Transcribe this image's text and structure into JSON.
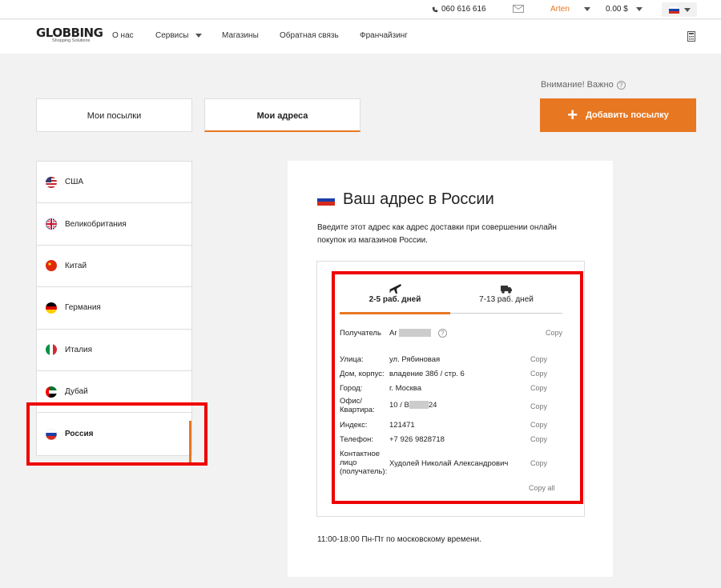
{
  "topbar": {
    "phone": "060 616 616",
    "user": "Arten",
    "balance": "0.00 $"
  },
  "nav": {
    "logo": "GLOBBING",
    "logo_sub": "Shopping Solutions",
    "links": [
      "О нас",
      "Сервисы",
      "Магазины",
      "Обратная связь",
      "Франчайзинг"
    ]
  },
  "notice": "Внимание! Важно",
  "tabs": {
    "parcels": "Мои посылки",
    "addresses": "Мои адреса"
  },
  "add_button": "Добавить посылку",
  "countries": [
    "США",
    "Великобритания",
    "Китай",
    "Германия",
    "Италия",
    "Дубай",
    "Россия"
  ],
  "card": {
    "title": "Ваш адрес в России",
    "description": "Введите этот адрес как адрес доставки при совершении онлайн покупок из магазинов России.",
    "ship_air": "2-5 раб. дней",
    "ship_truck": "7-13 раб. дней",
    "recipient_label": "Получатель",
    "recipient_value": "Ar",
    "rows": [
      {
        "label": "Улица:",
        "value": "ул. Рябиновая"
      },
      {
        "label": "Дом, корпус:",
        "value": "владение 38б / стр. 6"
      },
      {
        "label": "Город:",
        "value": "г. Москва"
      },
      {
        "label": "Офис/ Квартира:",
        "value": "10 / B",
        "suffix": "24"
      },
      {
        "label": "Индекс:",
        "value": "121471"
      },
      {
        "label": "Телефон:",
        "value": "+7 926 9828718"
      },
      {
        "label": "Контактное лицо (получатель):",
        "value": "Худолей Николай Александрович"
      }
    ],
    "copy": "Copy",
    "copy_all": "Copy all",
    "hours": "11:00-18:00 Пн-Пт по московскому времени."
  }
}
